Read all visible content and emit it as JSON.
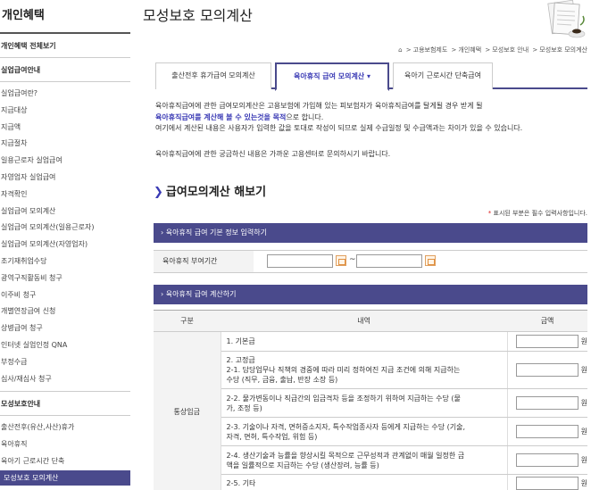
{
  "sidebar": {
    "title": "개인혜택",
    "all_benefits": "개인혜택 전체보기",
    "unemployment_head": "실업급여안내",
    "unemployment_items": [
      "실업급여란?",
      "지급대상",
      "지급액",
      "지급절차",
      "일용근로자 실업급여",
      "자영업자 실업급여",
      "자격확인",
      "실업급여 모의계산",
      "실업급여 모의계산(일용근로자)",
      "실업급여 모의계산(자영업자)",
      "조기재취업수당",
      "광역구직활동비 청구",
      "이주비 청구",
      "개별연장급여 신청",
      "상병급여 청구",
      "인터넷 실업인정 QNA",
      "부정수급",
      "심사/재심사 청구"
    ],
    "maternity_head": "모성보호안내",
    "maternity_items": [
      "출산전후(유산,사산)휴가",
      "육아휴직",
      "육아기 근로시간 단축",
      "모성보호 모의계산"
    ]
  },
  "page": {
    "title": "모성보호 모의계산"
  },
  "breadcrumb": [
    "고용보험제도",
    "개인혜택",
    "모성보호 안내",
    "모성보호 모의계산"
  ],
  "tabs": [
    {
      "label": "출산전후 휴가급여 모의계산"
    },
    {
      "label": "육아휴직 급여 모의계산"
    },
    {
      "label": "육아기 근로시간 단축급여"
    }
  ],
  "intro": {
    "line1": "육아휴직급여에 관한 급여모의계산은 고용보험에 가입해 있는 피보험자가 육아휴직급여를 탈게될 경우 받게 될",
    "line2_em": "육아휴직급여를 계산해 볼 수 있는것을 목적",
    "line2_rest": "으로 합니다.",
    "line3": "여기에서 계산된 내용은 사용자가 입력한 값을 토대로 작성이 되므로 실제 수급일정 및 수급액과는 차이가 있을 수 있습니다.",
    "line4": "육아휴직급여에 관한 궁금하신 내용은 가까운 고용센터로 문의하시기 바랍니다."
  },
  "section": {
    "title": "급여모의계산 해보기",
    "required_note": "표시된 부분은 필수 입력사항입니다."
  },
  "basic_info": {
    "bar_label": "육아휴직 급여 기본 정보 입력하기",
    "period_label": "육아휴직 부여기간",
    "start_value": "",
    "end_value": ""
  },
  "calc": {
    "bar_label": "육아휴직 급여 계산하기",
    "headers": {
      "category": "구분",
      "desc": "내역",
      "amount": "금액"
    },
    "category": "통상임금",
    "won": "원",
    "rows": [
      {
        "line1": "1. 기본급",
        "line2": "",
        "line3": ""
      },
      {
        "line1": "2. 고정급",
        "line2": "2-1. 담당업무나 직책의 경중에 따라 미리 정하여진 지급 조건에 의해 지급하는",
        "line3": "수당 (직무, 금융, 출납, 반장 소장 등)"
      },
      {
        "line1": "2-2. 물가변동이나 직급간의 임금격차 등을 조정하기 위하여 지급하는 수당 (물",
        "line2": "가, 조정 등)",
        "line3": ""
      },
      {
        "line1": "2-3. 기술이나 자격, 면허증소지자, 특수작업종사자 등에게 지급하는 수당 (기술,",
        "line2": "자격, 면허, 특수작업, 위험 등)",
        "line3": ""
      },
      {
        "line1": "2-4. 생산기술과 능률을 향상시킬 목적으로 근무성적과 관계없이 매월 일정한 금",
        "line2": "액을 일률적으로 지급하는 수당 (생산장려, 능률 등)",
        "line3": ""
      },
      {
        "line1": "2-5. 기타",
        "line2": "",
        "line3": ""
      }
    ]
  },
  "colors": {
    "accent": "#4a4a8c",
    "link": "#3b3bb5",
    "required": "#dd2222"
  }
}
